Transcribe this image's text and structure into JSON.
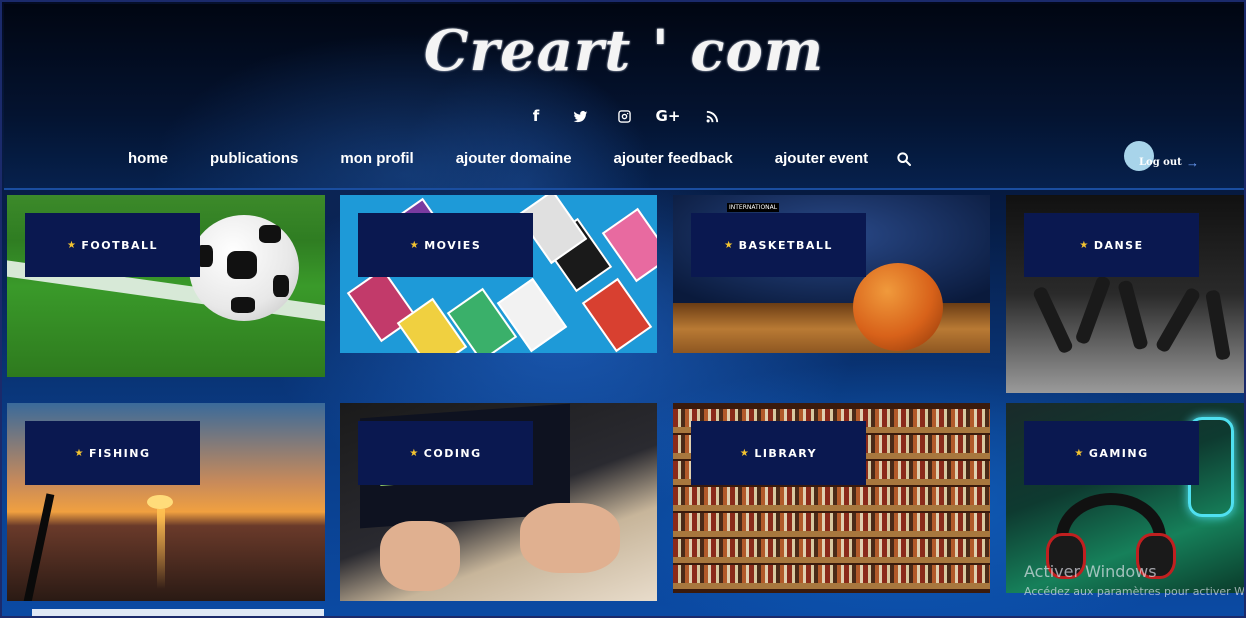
{
  "site": {
    "logo": "Creart ' com"
  },
  "socials": [
    {
      "icon": "facebook-icon",
      "glyph": "f"
    },
    {
      "icon": "twitter-icon",
      "glyph": ""
    },
    {
      "icon": "instagram-icon",
      "glyph": ""
    },
    {
      "icon": "google-plus-icon",
      "glyph": "G+"
    },
    {
      "icon": "rss-icon",
      "glyph": ""
    }
  ],
  "nav": {
    "items": [
      {
        "label": "home"
      },
      {
        "label": "publications"
      },
      {
        "label": "mon profil"
      },
      {
        "label": "ajouter domaine"
      },
      {
        "label": "ajouter feedback"
      },
      {
        "label": "ajouter event"
      }
    ],
    "search_icon": "search-icon",
    "logout_label": "Log out",
    "logout_arrow": "→"
  },
  "tiles": [
    {
      "label": "FOOTBALL"
    },
    {
      "label": "MOVIES"
    },
    {
      "label": "BASKETBALL",
      "badge": "INTERNATIONAL"
    },
    {
      "label": "DANSE"
    },
    {
      "label": "FISHING"
    },
    {
      "label": "CODING"
    },
    {
      "label": "LIBRARY"
    },
    {
      "label": "GAMING"
    }
  ],
  "star_glyph": "★",
  "watermark": {
    "title": "Activer Windows",
    "subtitle": "Accédez aux paramètres pour activer Wi"
  },
  "colors": {
    "label_bg": "#0a1850",
    "star": "#f4c430",
    "accent": "#1a4ea0"
  }
}
